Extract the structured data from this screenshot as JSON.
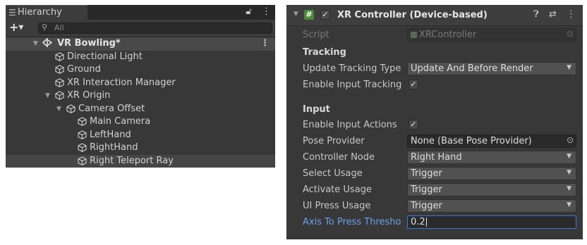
{
  "hierarchy": {
    "tab_label": "Hierarchy",
    "tab_icon": "list-icon",
    "tools": [
      "lock-icon",
      "kebab-menu-icon"
    ],
    "add_label": "+",
    "search_placeholder": "All",
    "scene": {
      "name": "VR Bowling*"
    },
    "items": [
      {
        "label": "Directional Light",
        "depth": 1,
        "expanded": null
      },
      {
        "label": "Ground",
        "depth": 1,
        "expanded": null
      },
      {
        "label": "XR Interaction Manager",
        "depth": 1,
        "expanded": null
      },
      {
        "label": "XR Origin",
        "depth": 1,
        "expanded": true
      },
      {
        "label": "Camera Offset",
        "depth": 2,
        "expanded": true
      },
      {
        "label": "Main Camera",
        "depth": 3,
        "expanded": null
      },
      {
        "label": "LeftHand",
        "depth": 3,
        "expanded": null
      },
      {
        "label": "RightHand",
        "depth": 3,
        "expanded": null
      },
      {
        "label": "Right Teleport Ray",
        "depth": 3,
        "expanded": null,
        "selected": true
      }
    ]
  },
  "inspector": {
    "component_title": "XR Controller (Device-based)",
    "component_enabled": true,
    "header_icons": [
      "help-icon",
      "preset-icon",
      "kebab-menu-icon"
    ],
    "script_label": "Script",
    "script_value": "XRController",
    "tracking_header": "Tracking",
    "update_tracking_type_label": "Update Tracking Type",
    "update_tracking_type_value": "Update And Before Render",
    "enable_input_tracking_label": "Enable Input Tracking",
    "enable_input_tracking": true,
    "input_header": "Input",
    "enable_input_actions_label": "Enable Input Actions",
    "enable_input_actions": true,
    "pose_provider_label": "Pose Provider",
    "pose_provider_value": "None (Base Pose Provider)",
    "controller_node_label": "Controller Node",
    "controller_node_value": "Right Hand",
    "select_usage_label": "Select Usage",
    "select_usage_value": "Trigger",
    "activate_usage_label": "Activate Usage",
    "activate_usage_value": "Trigger",
    "ui_press_usage_label": "UI Press Usage",
    "ui_press_usage_value": "Trigger",
    "axis_to_press_label": "Axis To Press Thresho",
    "axis_to_press_value": "0.2"
  },
  "colors": {
    "panel_bg": "#383838",
    "selection_row": "#454545",
    "focus_blue": "#3a79d8",
    "script_icon_green": "#4a8a3a"
  }
}
